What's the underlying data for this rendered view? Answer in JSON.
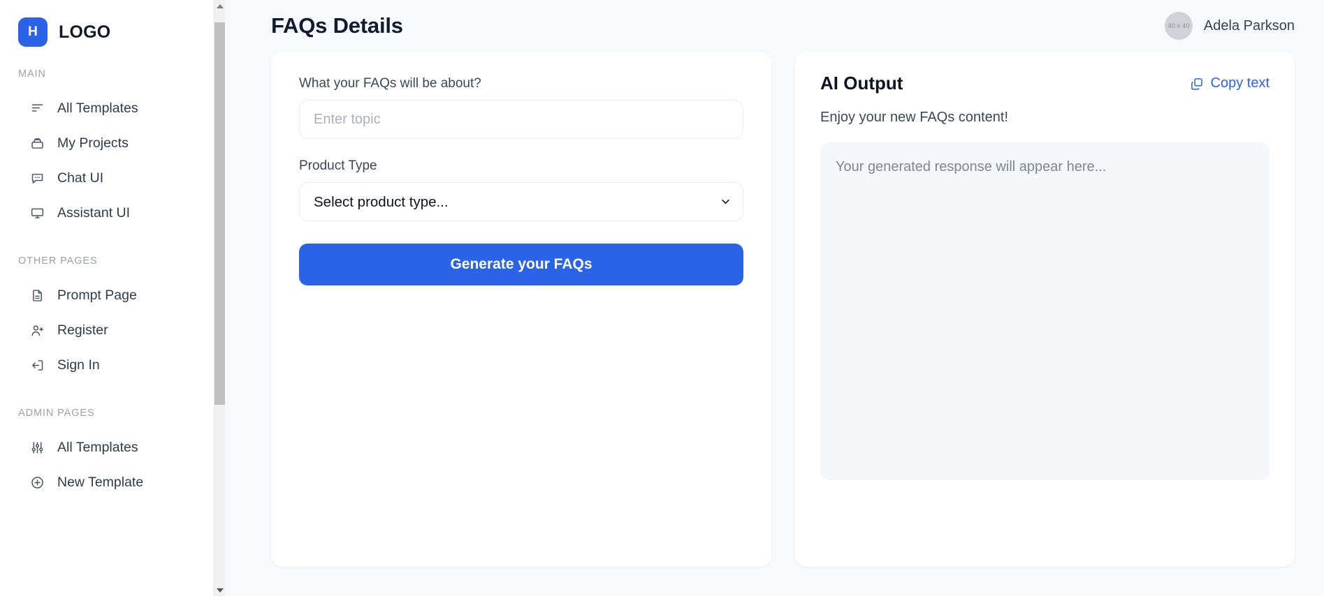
{
  "sidebar": {
    "brand": {
      "mark": "H",
      "name": "LOGO"
    },
    "sections": [
      {
        "label": "MAIN",
        "items": [
          {
            "label": "All Templates",
            "icon": "align-left-icon"
          },
          {
            "label": "My Projects",
            "icon": "briefcase-icon"
          },
          {
            "label": "Chat UI",
            "icon": "message-dots-icon"
          },
          {
            "label": "Assistant UI",
            "icon": "monitor-icon"
          }
        ]
      },
      {
        "label": "OTHER PAGES",
        "items": [
          {
            "label": "Prompt Page",
            "icon": "document-icon"
          },
          {
            "label": "Register",
            "icon": "user-plus-icon"
          },
          {
            "label": "Sign In",
            "icon": "login-arrow-icon"
          }
        ]
      },
      {
        "label": "ADMIN PAGES",
        "items": [
          {
            "label": "All Templates",
            "icon": "sliders-icon"
          },
          {
            "label": "New Template",
            "icon": "plus-circle-icon"
          }
        ]
      }
    ],
    "scrollbar": {
      "up_arrow": "scroll-up",
      "down_arrow": "scroll-down"
    }
  },
  "topbar": {
    "title": "FAQs Details",
    "user": {
      "name": "Adela Parkson",
      "avatar_placeholder": "40 x 40"
    }
  },
  "form": {
    "topic_label": "What your FAQs will be about?",
    "topic_value": "",
    "topic_placeholder": "Enter topic",
    "product_type_label": "Product Type",
    "product_type_selected": "Select product type...",
    "product_type_options": [
      "Select product type..."
    ],
    "submit_label": "Generate your FAQs"
  },
  "ai_output": {
    "title": "AI Output",
    "copy_label": "Copy text",
    "copy_icon": "copy-icon",
    "subtitle": "Enjoy your new FAQs content!",
    "placeholder": "Your generated response will appear here...",
    "value": ""
  },
  "colors": {
    "accent": "#2a62e8",
    "page_bg": "#f7f9fc",
    "card_bg": "#ffffff",
    "output_bg": "#f5f7fa",
    "title": "#101a33",
    "muted": "#9aa1ac"
  }
}
